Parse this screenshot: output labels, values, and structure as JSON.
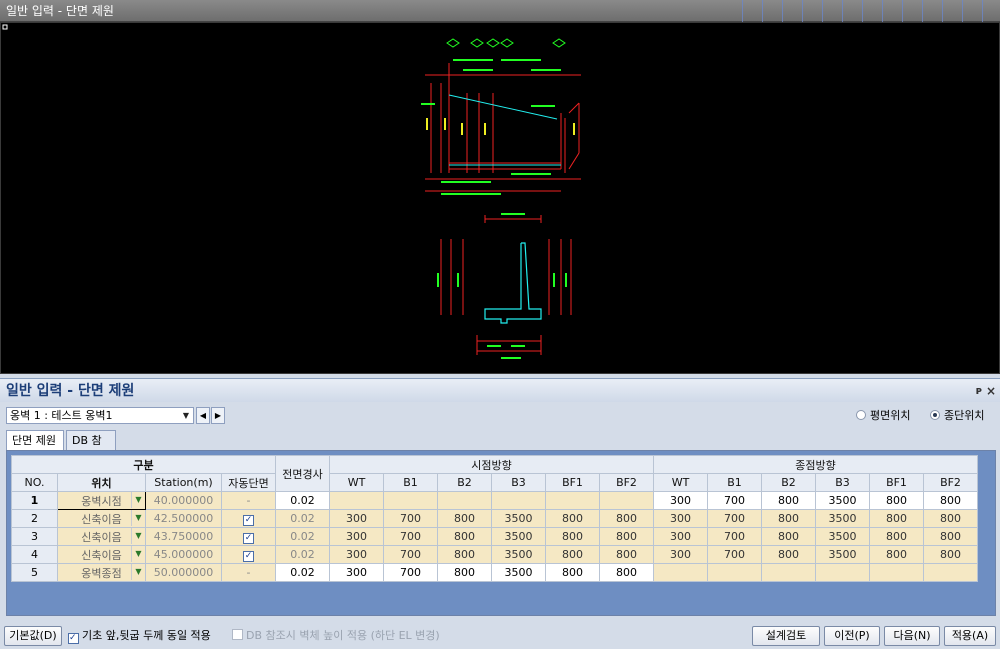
{
  "viewport": {
    "title": "일반 입력 - 단면 제원"
  },
  "panel": {
    "title": "일반 입력 - 단면 제원",
    "pin": "ᴘ",
    "close": "×"
  },
  "wall_select": {
    "value": "옹벽 1 : 테스트 옹벽1"
  },
  "position_mode": {
    "plan_label": "평면위치",
    "profile_label": "종단위치",
    "selected": "profile"
  },
  "tabs": [
    {
      "label": "단면 제원"
    },
    {
      "label": "DB 참조"
    }
  ],
  "table": {
    "group_headers": {
      "category": "구분",
      "front_slope": "전면경사",
      "start": "시점방향",
      "end": "종점방향"
    },
    "columns": {
      "no": "NO.",
      "loc": "위치",
      "station": "Station(m)",
      "auto": "자동단면"
    },
    "dims": [
      "WT",
      "B1",
      "B2",
      "B3",
      "BF1",
      "BF2"
    ],
    "rows": [
      {
        "no": "1",
        "loc": "옹벽시점",
        "station": "40.000000",
        "auto": "-",
        "slope": "0.02",
        "start": [
          "",
          "",
          "",
          "",
          "",
          ""
        ],
        "end": [
          "300",
          "700",
          "800",
          "3500",
          "800",
          "800"
        ]
      },
      {
        "no": "2",
        "loc": "신축이음",
        "station": "42.500000",
        "auto": "check",
        "slope": "0.02",
        "start": [
          "300",
          "700",
          "800",
          "3500",
          "800",
          "800"
        ],
        "end": [
          "300",
          "700",
          "800",
          "3500",
          "800",
          "800"
        ]
      },
      {
        "no": "3",
        "loc": "신축이음",
        "station": "43.750000",
        "auto": "check",
        "slope": "0.02",
        "start": [
          "300",
          "700",
          "800",
          "3500",
          "800",
          "800"
        ],
        "end": [
          "300",
          "700",
          "800",
          "3500",
          "800",
          "800"
        ]
      },
      {
        "no": "4",
        "loc": "신축이음",
        "station": "45.000000",
        "auto": "check",
        "slope": "0.02",
        "start": [
          "300",
          "700",
          "800",
          "3500",
          "800",
          "800"
        ],
        "end": [
          "300",
          "700",
          "800",
          "3500",
          "800",
          "800"
        ]
      },
      {
        "no": "5",
        "loc": "옹벽종점",
        "station": "50.000000",
        "auto": "-",
        "slope": "0.02",
        "start": [
          "300",
          "700",
          "800",
          "3500",
          "800",
          "800"
        ],
        "end": [
          "",
          "",
          "",
          "",
          "",
          ""
        ]
      }
    ]
  },
  "footer": {
    "default_button": "기본값(D)",
    "same_thickness_label": "기초 앞,뒷굽 두께 동일 적용",
    "db_height_label": "DB 참조시 벽체 높이 적용 (하단 EL 변경)",
    "design_check": "설계검토",
    "prev": "이전(P)",
    "next": "다음(N)",
    "apply": "적용(A)"
  },
  "colors": {
    "accent": "#1c3e78",
    "grid_bg": "#6e8ec2",
    "readonly_cell": "#f5e8c4"
  }
}
